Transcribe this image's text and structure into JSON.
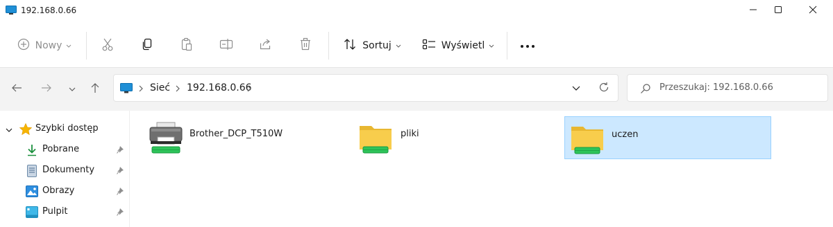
{
  "window": {
    "title": "192.168.0.66",
    "icon": "monitor-icon",
    "controls": [
      "minimize-icon",
      "maximize-icon",
      "close-icon"
    ]
  },
  "toolbar": {
    "new_label": "Nowy",
    "sort_label": "Sortuj",
    "view_label": "Wyświetl",
    "icons": [
      "cut-icon",
      "copy-icon",
      "paste-icon",
      "rename-icon",
      "share-icon",
      "delete-icon",
      "more-icon"
    ]
  },
  "address": {
    "crumbs": [
      "Sieć",
      "192.168.0.66"
    ],
    "search_placeholder": "Przeszukaj: 192.168.0.66"
  },
  "sidebar": {
    "quick_access": "Szybki dostęp",
    "items": [
      {
        "label": "Pobrane",
        "icon": "download-icon",
        "pinned": true
      },
      {
        "label": "Dokumenty",
        "icon": "documents-icon",
        "pinned": true
      },
      {
        "label": "Obrazy",
        "icon": "pictures-icon",
        "pinned": true
      },
      {
        "label": "Pulpit",
        "icon": "desktop-icon",
        "pinned": true
      }
    ]
  },
  "content": {
    "items": [
      {
        "label": "Brother_DCP_T510W",
        "type": "printer",
        "selected": false
      },
      {
        "label": "pliki",
        "type": "shared-folder",
        "selected": false
      },
      {
        "label": "uczen",
        "type": "shared-folder",
        "selected": true
      }
    ]
  },
  "colors": {
    "selection_bg": "#cce8ff",
    "selection_border": "#99d1ff",
    "folder_yellow": "#f8cd4c",
    "share_green": "#2ec45a",
    "accent_blue": "#0078d4"
  }
}
